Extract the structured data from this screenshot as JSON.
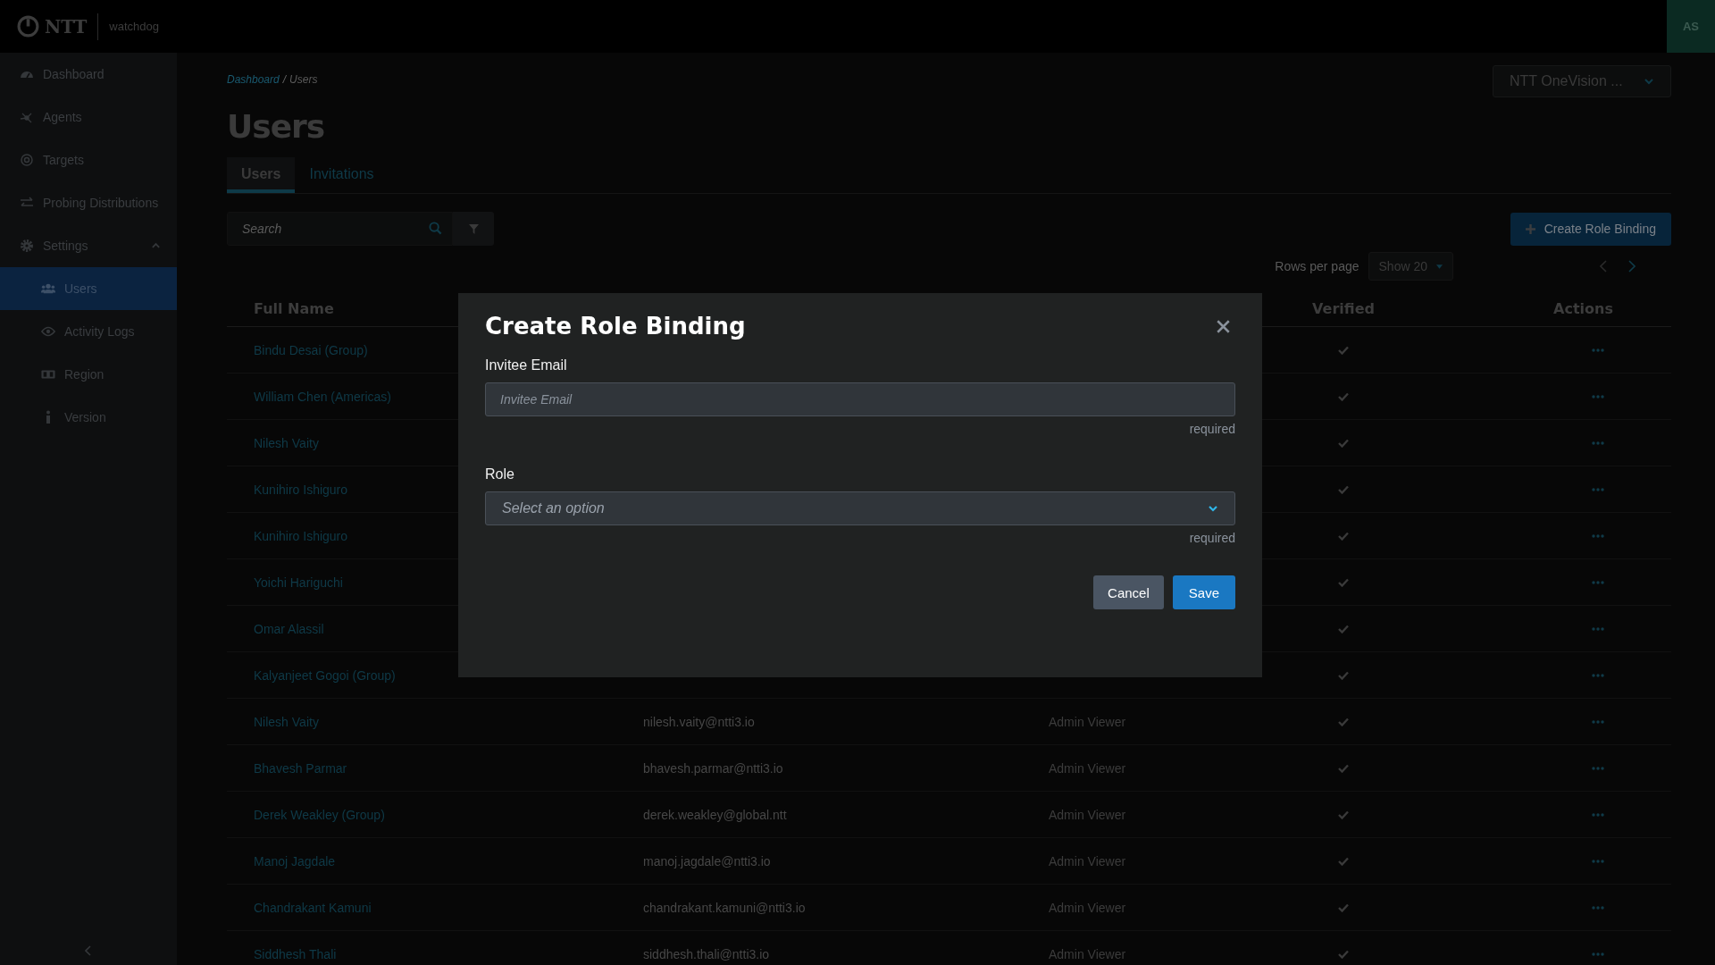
{
  "header": {
    "logo_text": "NTT",
    "product": "watchdog",
    "avatar": "AS"
  },
  "sidebar": {
    "items": [
      {
        "label": "Dashboard",
        "selected": false
      },
      {
        "label": "Agents",
        "selected": false
      },
      {
        "label": "Targets",
        "selected": false
      },
      {
        "label": "Probing Distributions",
        "selected": false
      },
      {
        "label": "Settings",
        "selected": false,
        "expanded": true,
        "children": [
          {
            "label": "Users",
            "selected": true
          },
          {
            "label": "Activity Logs",
            "selected": false
          },
          {
            "label": "Region",
            "selected": false
          },
          {
            "label": "Version",
            "selected": false
          }
        ]
      }
    ]
  },
  "breadcrumb": [
    "Dashboard",
    "Users"
  ],
  "breadcrumb_separator": "/",
  "org_selector": {
    "value": "NTT OneVision ..."
  },
  "page_title": "Users",
  "tabs": [
    {
      "label": "Users",
      "selected": true
    },
    {
      "label": "Invitations",
      "selected": false
    }
  ],
  "search": {
    "placeholder": "Search"
  },
  "create_button": "Create Role Binding",
  "pagination": {
    "label": "Rows per page",
    "value": "Show 20"
  },
  "table": {
    "columns": [
      "Full Name",
      "Verified",
      "Actions"
    ],
    "rows": [
      {
        "name": "Bindu Desai (Group)",
        "verified": true
      },
      {
        "name": "William Chen (Americas)",
        "verified": true
      },
      {
        "name": "Nilesh Vaity",
        "verified": true
      },
      {
        "name": "Kunihiro Ishiguro",
        "verified": true
      },
      {
        "name": "Kunihiro Ishiguro",
        "verified": true
      },
      {
        "name": "Yoichi Hariguchi",
        "verified": true
      },
      {
        "name": "Omar Alassil",
        "verified": true
      },
      {
        "name": "Kalyanjeet Gogoi (Group)",
        "verified": true
      },
      {
        "name": "Nilesh Vaity",
        "email": "nilesh.vaity@ntti3.io",
        "role": "Admin Viewer",
        "verified": true
      },
      {
        "name": "Bhavesh Parmar",
        "email": "bhavesh.parmar@ntti3.io",
        "role": "Admin Viewer",
        "verified": true
      },
      {
        "name": "Derek Weakley (Group)",
        "email": "derek.weakley@global.ntt",
        "role": "Admin Viewer",
        "verified": true
      },
      {
        "name": "Manoj Jagdale",
        "email": "manoj.jagdale@ntti3.io",
        "role": "Admin Viewer",
        "verified": true
      },
      {
        "name": "Chandrakant Kamuni",
        "email": "chandrakant.kamuni@ntti3.io",
        "role": "Admin Viewer",
        "verified": true
      },
      {
        "name": "Siddhesh Thali",
        "email": "siddhesh.thali@ntti3.io",
        "role": "Admin Viewer",
        "verified": true
      }
    ]
  },
  "modal": {
    "title": "Create Role Binding",
    "fields": [
      {
        "kind": "text",
        "label": "Invitee Email",
        "placeholder": "Invitee Email",
        "hint": "required"
      },
      {
        "kind": "select",
        "label": "Role",
        "placeholder": "Select an option",
        "hint": "required"
      }
    ],
    "buttons": [
      {
        "label": "Cancel",
        "kind": "secondary"
      },
      {
        "label": "Save",
        "kind": "primary"
      }
    ]
  }
}
